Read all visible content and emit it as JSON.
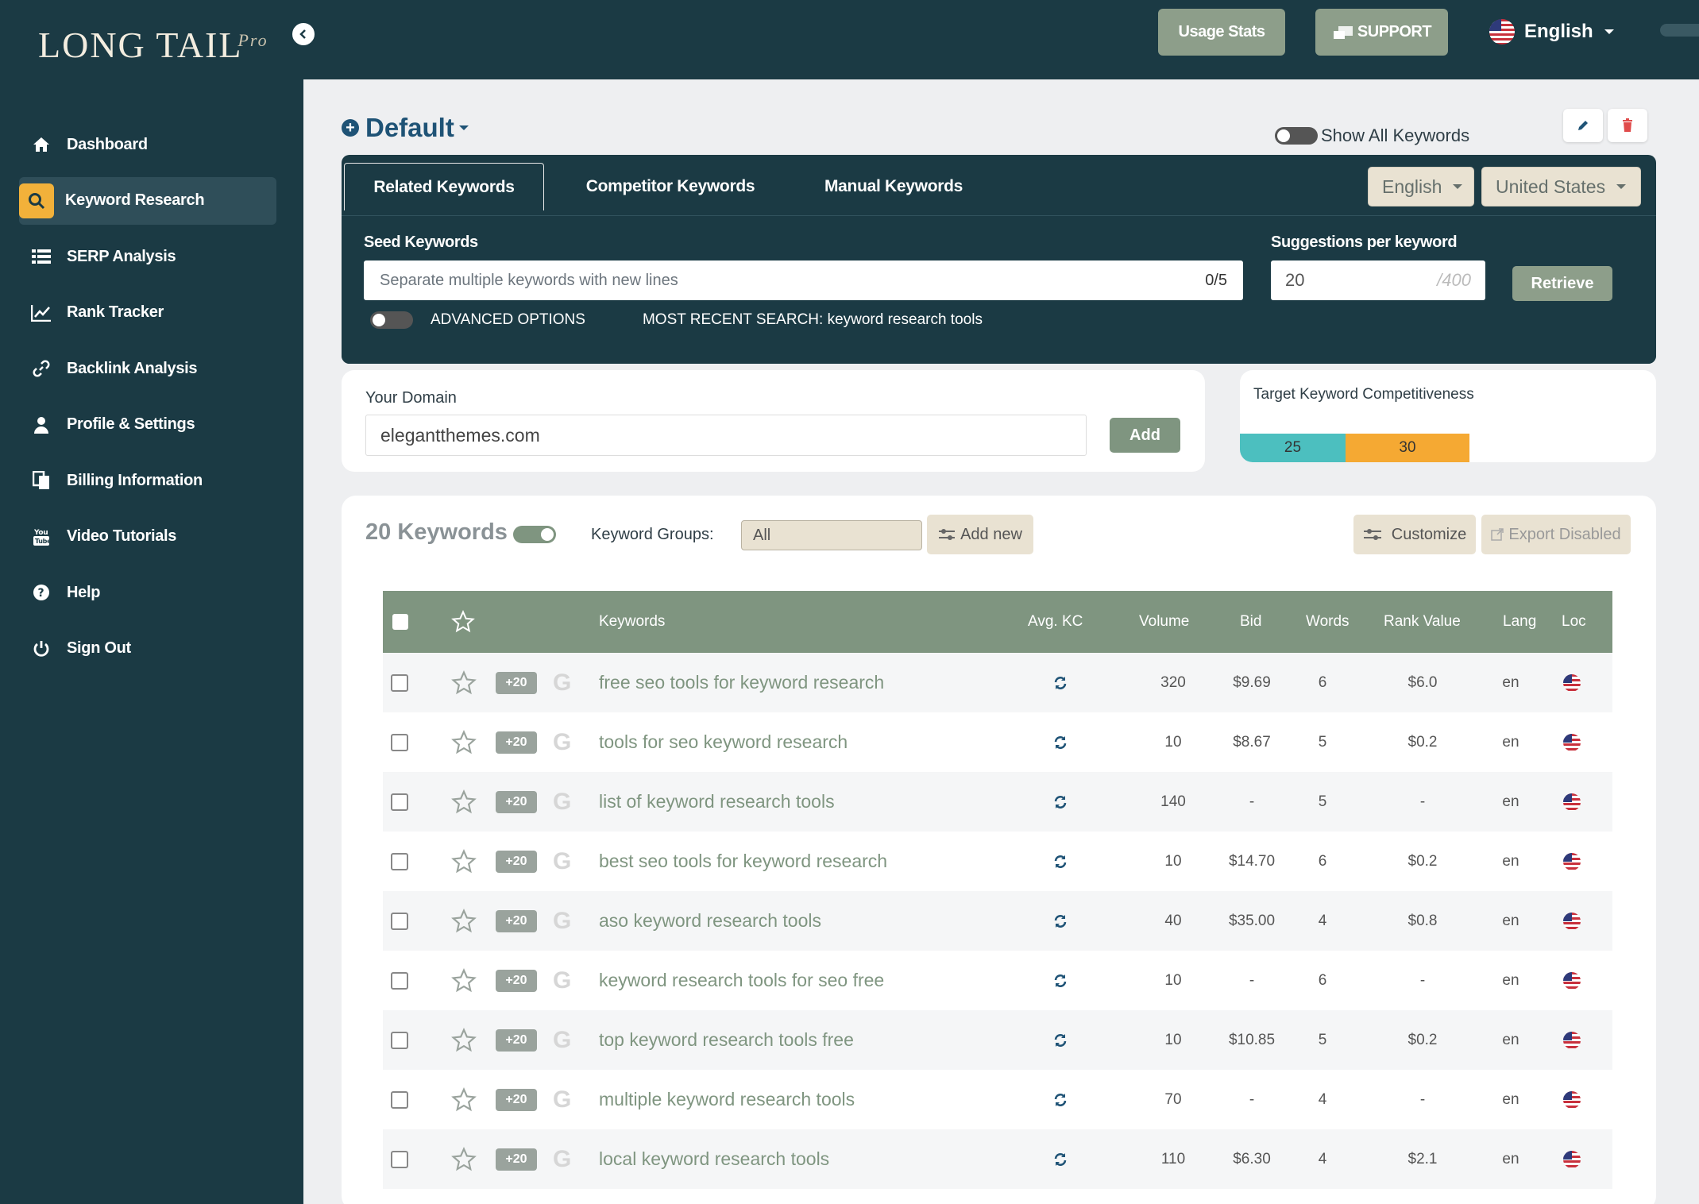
{
  "app": {
    "logo_text": "LONG TAIL",
    "logo_suffix": "Pro"
  },
  "sidebar": {
    "items": [
      {
        "label": "Dashboard",
        "icon": "home-icon"
      },
      {
        "label": "Keyword Research",
        "icon": "search-icon",
        "active": true
      },
      {
        "label": "SERP Analysis",
        "icon": "list-icon"
      },
      {
        "label": "Rank Tracker",
        "icon": "chart-line-icon"
      },
      {
        "label": "Backlink Analysis",
        "icon": "link-icon"
      },
      {
        "label": "Profile & Settings",
        "icon": "user-icon"
      },
      {
        "label": "Billing Information",
        "icon": "file-copy-icon"
      },
      {
        "label": "Video Tutorials",
        "icon": "youtube-icon"
      },
      {
        "label": "Help",
        "icon": "question-circle-icon"
      },
      {
        "label": "Sign Out",
        "icon": "power-icon"
      }
    ]
  },
  "topbar": {
    "usage_label": "Usage Stats",
    "support_label": "SUPPORT",
    "language": "English"
  },
  "project": {
    "name": "Default",
    "show_all_label": "Show All Keywords"
  },
  "search": {
    "tabs": [
      "Related Keywords",
      "Competitor Keywords",
      "Manual Keywords"
    ],
    "language": "English",
    "country": "United States",
    "seed_label": "Seed Keywords",
    "seed_placeholder": "Separate multiple keywords with new lines",
    "seed_count": "0/5",
    "suggestions_label": "Suggestions per keyword",
    "suggestions_value": "20",
    "suggestions_max": "/400",
    "retrieve_label": "Retrieve",
    "advanced_label": "ADVANCED OPTIONS",
    "recent_label": "MOST RECENT SEARCH: keyword research tools"
  },
  "domain": {
    "label": "Your Domain",
    "value": "elegantthemes.com",
    "add_label": "Add"
  },
  "competitiveness": {
    "label": "Target Keyword Competitiveness",
    "low": "25",
    "high": "30",
    "low_color": "#4cbfbf",
    "high_color": "#f5a933"
  },
  "keywords": {
    "title": "20 Keywords",
    "groups_label": "Keyword Groups:",
    "groups_value": "All",
    "add_new_label": "Add new",
    "customize_label": "Customize",
    "export_label": "Export Disabled",
    "columns": {
      "keyword": "Keywords",
      "kc": "Avg. KC",
      "volume": "Volume",
      "bid": "Bid",
      "words": "Words",
      "rank": "Rank Value",
      "lang": "Lang",
      "loc": "Loc"
    },
    "plus_badge": "+20",
    "rows": [
      {
        "keyword": "free seo tools for keyword research",
        "volume": "320",
        "bid": "$9.69",
        "words": "6",
        "rank": "$6.0",
        "lang": "en"
      },
      {
        "keyword": "tools for seo keyword research",
        "volume": "10",
        "bid": "$8.67",
        "words": "5",
        "rank": "$0.2",
        "lang": "en"
      },
      {
        "keyword": "list of keyword research tools",
        "volume": "140",
        "bid": "-",
        "words": "5",
        "rank": "-",
        "lang": "en"
      },
      {
        "keyword": "best seo tools for keyword research",
        "volume": "10",
        "bid": "$14.70",
        "words": "6",
        "rank": "$0.2",
        "lang": "en"
      },
      {
        "keyword": "aso keyword research tools",
        "volume": "40",
        "bid": "$35.00",
        "words": "4",
        "rank": "$0.8",
        "lang": "en"
      },
      {
        "keyword": "keyword research tools for seo free",
        "volume": "10",
        "bid": "-",
        "words": "6",
        "rank": "-",
        "lang": "en"
      },
      {
        "keyword": "top keyword research tools free",
        "volume": "10",
        "bid": "$10.85",
        "words": "5",
        "rank": "$0.2",
        "lang": "en"
      },
      {
        "keyword": "multiple keyword research tools",
        "volume": "70",
        "bid": "-",
        "words": "4",
        "rank": "-",
        "lang": "en"
      },
      {
        "keyword": "local keyword research tools",
        "volume": "110",
        "bid": "$6.30",
        "words": "4",
        "rank": "$2.1",
        "lang": "en"
      }
    ]
  }
}
